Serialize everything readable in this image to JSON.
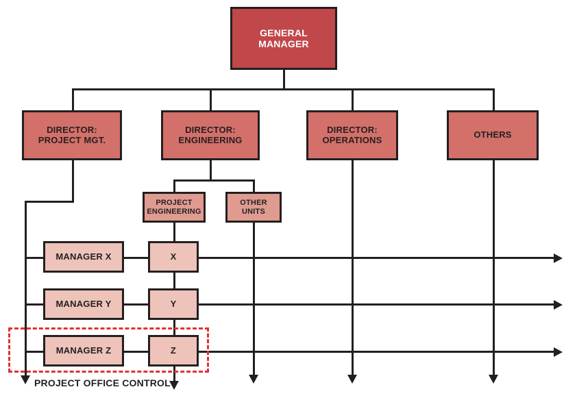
{
  "diagram": {
    "title": "Matrix organization chart",
    "colors": {
      "general_manager": "#c0474a",
      "director": "#d3706a",
      "unit": "#e09b91",
      "manager": "#eec3ba",
      "line": "#231f20",
      "highlight_dashed": "#e03131",
      "background": "#ffffff"
    },
    "nodes": {
      "general_manager": "GENERAL\nMANAGER",
      "director_project_mgt": "DIRECTOR:\nPROJECT MGT.",
      "director_engineering": "DIRECTOR:\nENGINEERING",
      "director_operations": "DIRECTOR:\nOPERATIONS",
      "others": "OTHERS",
      "project_engineering": "PROJECT\nENGINEERING",
      "other_units": "OTHER\nUNITS",
      "manager_x": "MANAGER X",
      "manager_y": "MANAGER Y",
      "manager_z": "MANAGER Z",
      "project_x": "X",
      "project_y": "Y",
      "project_z": "Z"
    },
    "annotation": {
      "project_office_control": "PROJECT OFFICE CONTROL"
    }
  }
}
